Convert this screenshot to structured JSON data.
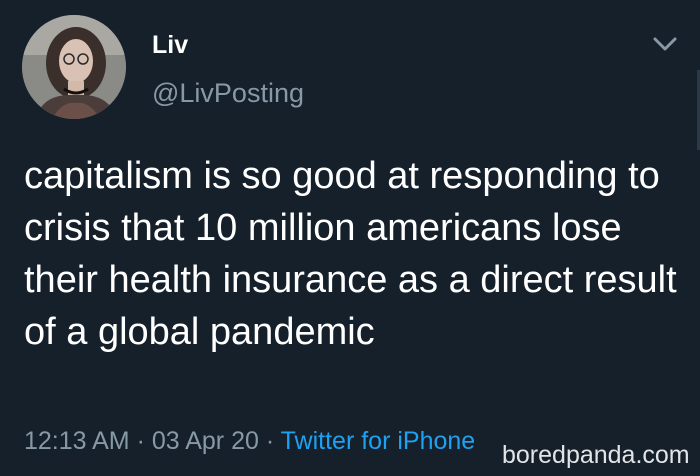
{
  "tweet": {
    "display_name": "Liv",
    "handle": "@LivPosting",
    "text": "capitalism is so good at responding to crisis that 10 million americans lose their health insurance as a direct result of a global pandemic",
    "time": "12:13 AM",
    "separator": " · ",
    "date": "03 Apr 20",
    "source": "Twitter for iPhone"
  },
  "watermark": "boredpanda.com",
  "icons": {
    "menu": "chevron-down-icon",
    "avatar": "profile-photo"
  },
  "colors": {
    "background": "#15202b",
    "secondary_text": "#8899a6",
    "link": "#1da1f2"
  }
}
